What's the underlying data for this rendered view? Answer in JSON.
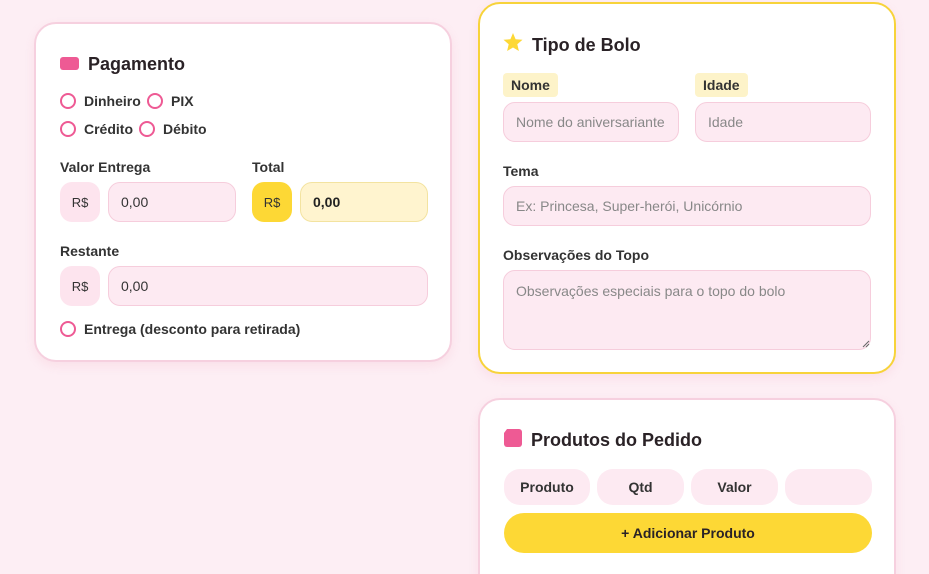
{
  "pagamento": {
    "title": "Pagamento",
    "icon": "credit-card-icon",
    "payment_methods": [
      "Dinheiro",
      "PIX",
      "Crédito",
      "Débito"
    ],
    "valor_entrega_label": "Valor Entrega",
    "valor_entrega_prefix": "R$",
    "valor_entrega_value": "0,00",
    "total_label": "Total",
    "total_prefix": "R$",
    "total_value": "0,00",
    "restante_label": "Restante",
    "restante_prefix": "R$",
    "restante_value": "0,00",
    "entrega_option": "Entrega (desconto para retirada)"
  },
  "tipo_bolo": {
    "title": "Tipo de Bolo",
    "icon": "star-icon",
    "nome_label": "Nome",
    "nome_placeholder": "Nome do aniversariante",
    "idade_label": "Idade",
    "idade_placeholder": "Idade",
    "tema_label": "Tema",
    "tema_placeholder": "Ex: Princesa, Super-herói, Unicórnio",
    "obs_label": "Observações do Topo",
    "obs_placeholder": "Observações especiais para o topo do bolo"
  },
  "produtos": {
    "title": "Produtos do Pedido",
    "icon": "tag-icon",
    "columns": [
      "Produto",
      "Qtd",
      "Valor",
      ""
    ],
    "add_button": "+ Adicionar Produto"
  },
  "colors": {
    "background": "#fdeef4",
    "accent_pink": "#ee5a94",
    "accent_yellow": "#fdd835"
  }
}
